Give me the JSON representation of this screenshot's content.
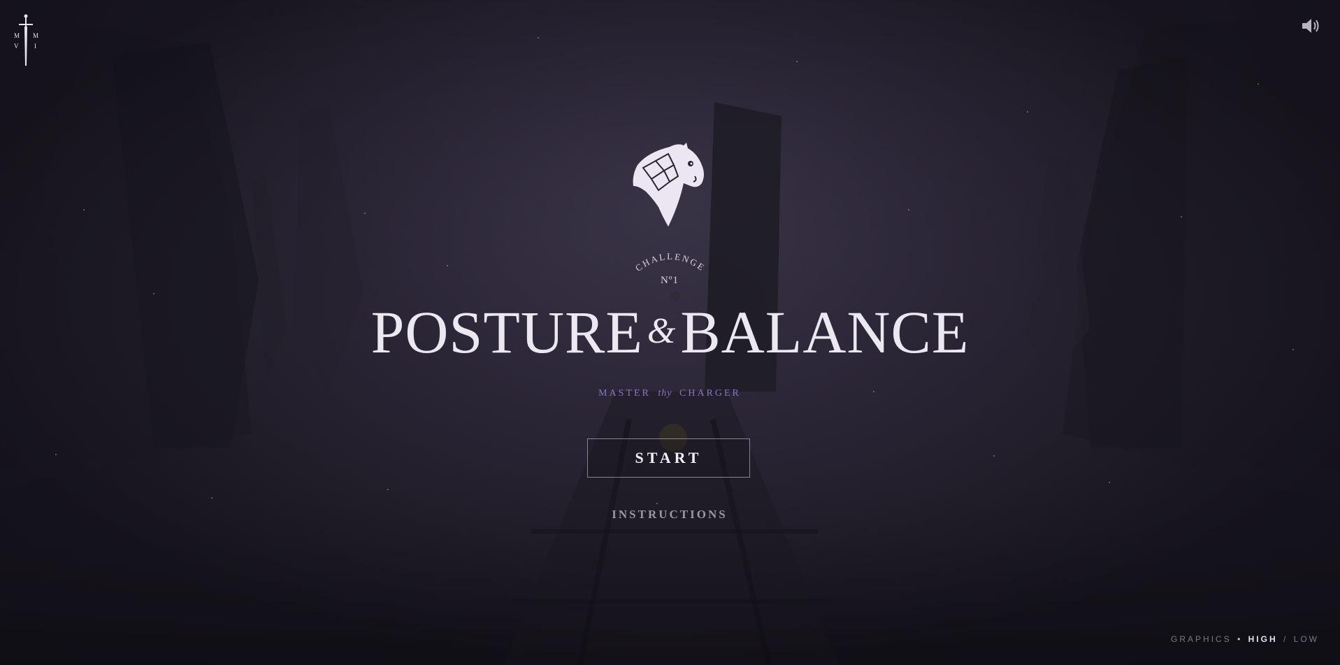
{
  "logo": {
    "letters": [
      "M",
      "M",
      "V",
      "I"
    ]
  },
  "sound": {
    "icon": "speaker-icon"
  },
  "emblem": {
    "icon": "horse-head-icon"
  },
  "challenge": {
    "label": "CHALLENGE",
    "number": "Nº1"
  },
  "title": {
    "left": "POSTURE",
    "ampersand": "&",
    "right": "BALANCE"
  },
  "tagline": {
    "before": "MASTER",
    "italic": "thy",
    "after": "CHARGER"
  },
  "menu": {
    "start_label": "START",
    "instructions_label": "INSTRUCTIONS"
  },
  "graphics": {
    "label": "GRAPHICS",
    "bullet": "•",
    "high": "HIGH",
    "separator": "/",
    "low": "LOW",
    "selected": "HIGH"
  },
  "colors": {
    "background": "#2a2535",
    "accent": "#8e74c3",
    "title": "#ece8f1"
  }
}
